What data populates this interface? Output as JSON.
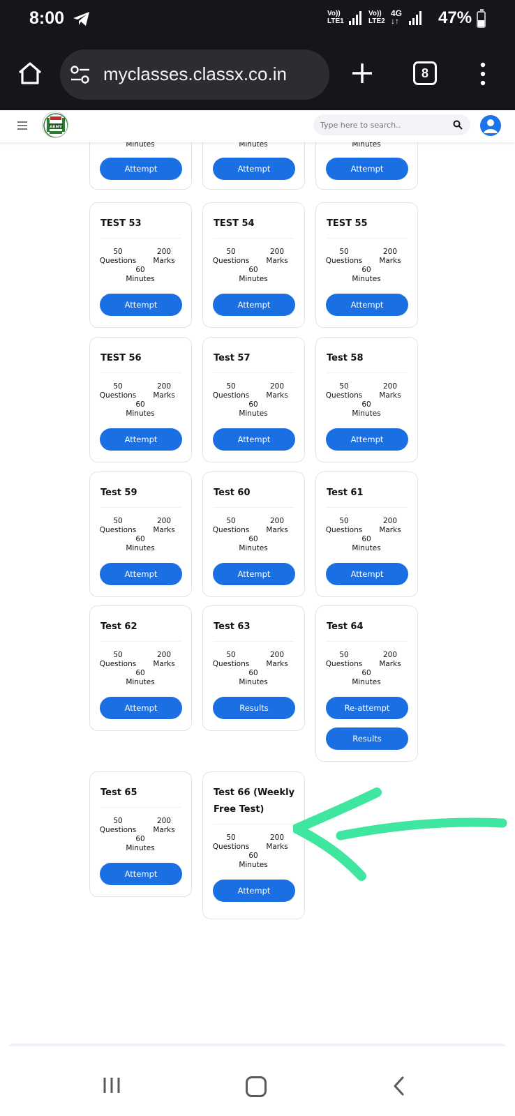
{
  "status_bar": {
    "time": "8:00",
    "sim1_top": "Vo))",
    "sim1_bottom": "LTE1",
    "sim2_top": "Vo))",
    "sim2_bottom": "LTE2",
    "network": "4G",
    "network_arrows": "↓↑",
    "battery_percent": "47%",
    "battery_level": 0.47
  },
  "browser": {
    "url": "myclasses.classx.co.in",
    "tab_count": "8"
  },
  "site_header": {
    "search_placeholder": "Type here to search..",
    "logo_text": "ARMY"
  },
  "partial_row": [
    {
      "minutes_label": "Minutes",
      "button": "Attempt"
    },
    {
      "minutes_label": "Minutes",
      "button": "Attempt"
    },
    {
      "minutes_label": "Minutes",
      "button": "Attempt"
    }
  ],
  "tests": [
    {
      "title": "TEST 53",
      "questions": "50",
      "questions_label": "Questions",
      "marks": "200",
      "marks_label": "Marks",
      "minutes": "60",
      "minutes_label": "Minutes",
      "buttons": [
        "Attempt"
      ]
    },
    {
      "title": "TEST 54",
      "questions": "50",
      "questions_label": "Questions",
      "marks": "200",
      "marks_label": "Marks",
      "minutes": "60",
      "minutes_label": "Minutes",
      "buttons": [
        "Attempt"
      ]
    },
    {
      "title": "TEST 55",
      "questions": "50",
      "questions_label": "Questions",
      "marks": "200",
      "marks_label": "Marks",
      "minutes": "60",
      "minutes_label": "Minutes",
      "buttons": [
        "Attempt"
      ]
    },
    {
      "title": "TEST 56",
      "questions": "50",
      "questions_label": "Questions",
      "marks": "200",
      "marks_label": "Marks",
      "minutes": "60",
      "minutes_label": "Minutes",
      "buttons": [
        "Attempt"
      ]
    },
    {
      "title": "Test 57",
      "questions": "50",
      "questions_label": "Questions",
      "marks": "200",
      "marks_label": "Marks",
      "minutes": "60",
      "minutes_label": "Minutes",
      "buttons": [
        "Attempt"
      ]
    },
    {
      "title": "Test 58",
      "questions": "50",
      "questions_label": "Questions",
      "marks": "200",
      "marks_label": "Marks",
      "minutes": "60",
      "minutes_label": "Minutes",
      "buttons": [
        "Attempt"
      ]
    },
    {
      "title": "Test 59",
      "questions": "50",
      "questions_label": "Questions",
      "marks": "200",
      "marks_label": "Marks",
      "minutes": "60",
      "minutes_label": "Minutes",
      "buttons": [
        "Attempt"
      ]
    },
    {
      "title": "Test 60",
      "questions": "50",
      "questions_label": "Questions",
      "marks": "200",
      "marks_label": "Marks",
      "minutes": "60",
      "minutes_label": "Minutes",
      "buttons": [
        "Attempt"
      ]
    },
    {
      "title": "Test 61",
      "questions": "50",
      "questions_label": "Questions",
      "marks": "200",
      "marks_label": "Marks",
      "minutes": "60",
      "minutes_label": "Minutes",
      "buttons": [
        "Attempt"
      ]
    },
    {
      "title": "Test 62",
      "questions": "50",
      "questions_label": "Questions",
      "marks": "200",
      "marks_label": "Marks",
      "minutes": "60",
      "minutes_label": "Minutes",
      "buttons": [
        "Attempt"
      ]
    },
    {
      "title": "Test 63",
      "questions": "50",
      "questions_label": "Questions",
      "marks": "200",
      "marks_label": "Marks",
      "minutes": "60",
      "minutes_label": "Minutes",
      "buttons": [
        "Results"
      ]
    },
    {
      "title": "Test 64",
      "questions": "50",
      "questions_label": "Questions",
      "marks": "200",
      "marks_label": "Marks",
      "minutes": "60",
      "minutes_label": "Minutes",
      "buttons": [
        "Re-attempt",
        "Results"
      ]
    },
    {
      "title": "Test 65",
      "questions": "50",
      "questions_label": "Questions",
      "marks": "200",
      "marks_label": "Marks",
      "minutes": "60",
      "minutes_label": "Minutes",
      "buttons": [
        "Attempt"
      ]
    },
    {
      "title": "Test 66 (Weekly Free Test)",
      "questions": "50",
      "questions_label": "Questions",
      "marks": "200",
      "marks_label": "Marks",
      "minutes": "60",
      "minutes_label": "Minutes",
      "buttons": [
        "Attempt"
      ]
    }
  ],
  "colors": {
    "primary_button": "#1a6fe3",
    "status_bar_bg": "#15161a",
    "annotation_arrow": "#3ee6a0"
  }
}
